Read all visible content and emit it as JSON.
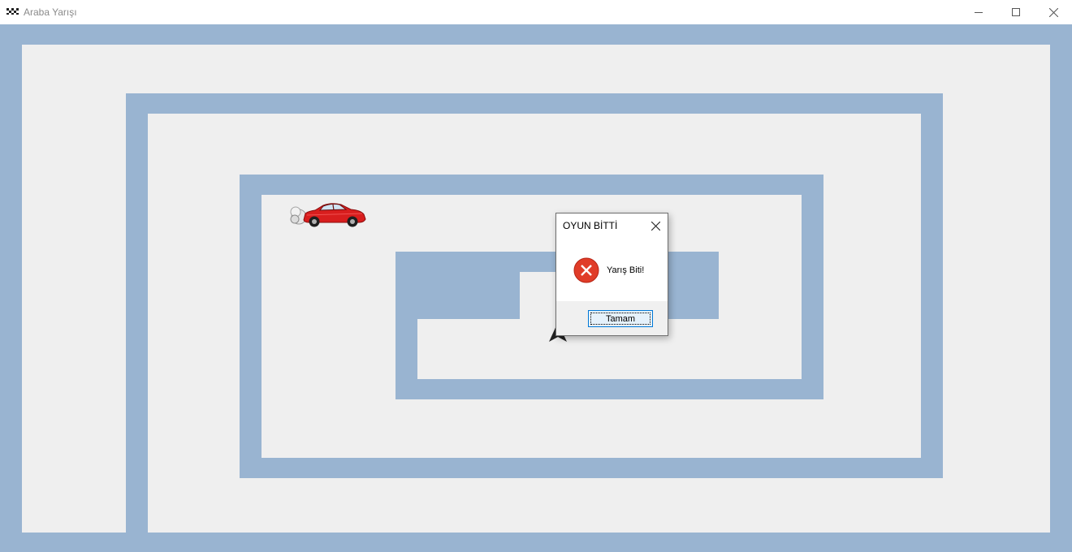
{
  "window": {
    "title": "Araba Yarışı",
    "app_icon": "checkered-race-flag-icon",
    "controls": [
      "minimize-icon",
      "maximize-icon",
      "close-icon"
    ]
  },
  "game": {
    "background_color": "#efefef",
    "wall_color": "#99b4d1",
    "player": "red-sports-car",
    "marker": "navigation-arrow-icon"
  },
  "dialog": {
    "title": "OYUN BİTTİ",
    "icon": "error-icon",
    "message": "Yarış Biti!",
    "ok_label": "Tamam"
  }
}
